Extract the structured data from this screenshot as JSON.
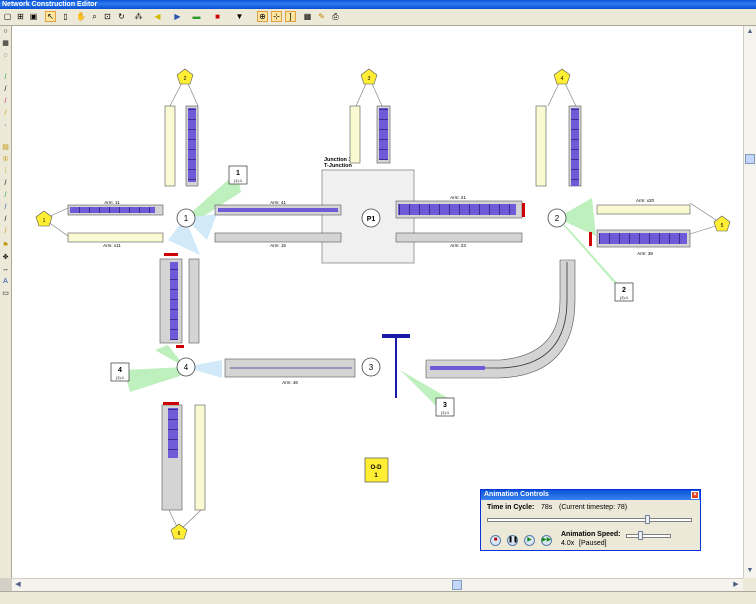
{
  "window": {
    "title": "Network Construction Editor"
  },
  "toolbar": {
    "icons": [
      "new-icon",
      "open-icon",
      "save-icon",
      "pointer-icon",
      "page-icon",
      "pan-icon",
      "zoom-icon",
      "zoom-window-icon",
      "refresh-icon",
      "signal-icon",
      "arrow-left-icon",
      "arrow-right-icon",
      "link-icon",
      "red-flag-icon",
      "filter-icon",
      "junction-tool-icon",
      "select-tool-icon",
      "bracket-icon",
      "grid-icon",
      "draw-icon",
      "export-icon"
    ]
  },
  "colors": {
    "canvas_bg": "#ffffff",
    "arm_fill": "#c8c8c8",
    "queue_blue": "#6f5ad8",
    "node_yellow": "#ffee33",
    "green_link": "#6ee06e",
    "title_blue": "#0a53d8"
  },
  "network": {
    "zones": {
      "z1": "1",
      "z2": "2",
      "z3": "3",
      "z4": "4",
      "z5": "5",
      "z6": "6"
    },
    "nodes": {
      "n1": "1",
      "n2": "2",
      "n3": "3",
      "n4": "4",
      "p1": "P1"
    },
    "boxes": {
      "b1": {
        "label": "1",
        "sub": "(1):1"
      },
      "b2": {
        "label": "2",
        "sub": "(2):1"
      },
      "b3": {
        "label": "3",
        "sub": "(1):1"
      },
      "b4": {
        "label": "4",
        "sub": "(1):1"
      }
    },
    "junction": {
      "line1": "Junction 1",
      "line2": "T-Junction"
    },
    "arms": {
      "arm11": "Arm: 11",
      "arm41": "Arm: 41",
      "arm21": "Arm: 21",
      "arm15": "Arm: 15",
      "arm23": "Arm: 23",
      "arm38": "Arm: 38",
      "arm46": "Arm: 46",
      "arm_x11": "Arm: x11",
      "arm_x20": "Arm: x20"
    },
    "od": {
      "line1": "O-D",
      "line2": "1"
    }
  },
  "animation": {
    "title": "Animation Controls",
    "time_label": "Time in Cycle:",
    "time_value": "78s",
    "timestep": "(Current timestep: 78)",
    "speed_label": "Animation Speed:",
    "speed_value": "4.0x",
    "status": "[Paused]",
    "cycle_fraction": 0.78,
    "buttons": [
      "stop-icon",
      "pause-icon",
      "play-icon",
      "fast-forward-icon"
    ]
  }
}
